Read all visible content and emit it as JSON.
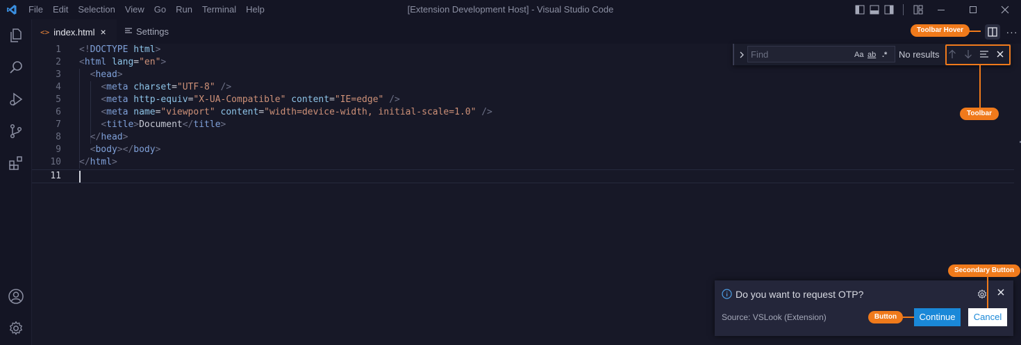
{
  "titlebar": {
    "menu": [
      "File",
      "Edit",
      "Selection",
      "View",
      "Go",
      "Run",
      "Terminal",
      "Help"
    ],
    "title": "[Extension Development Host] - Visual Studio Code"
  },
  "tabs": [
    {
      "label": "index.html",
      "icon": "html-file-icon",
      "close": "×",
      "active": true
    },
    {
      "label": "Settings",
      "icon": "settings-lines-icon",
      "active": false
    }
  ],
  "editor": {
    "line_numbers": [
      "1",
      "2",
      "3",
      "4",
      "5",
      "6",
      "7",
      "8",
      "9",
      "10",
      "11"
    ],
    "current_line": "11"
  },
  "find_widget": {
    "placeholder": "Find",
    "match_case": "Aa",
    "whole_word": "ab",
    "regex": ".*",
    "status": "No results"
  },
  "notification": {
    "message": "Do you want to request OTP?",
    "source": "Source: VSLook (Extension)",
    "primary_button": "Continue",
    "secondary_button": "Cancel"
  },
  "annotations": {
    "toolbar_hover": "Toolbar Hover",
    "toolbar": "Toolbar",
    "secondary_button": "Secondary Button",
    "button": "Button"
  },
  "colors": {
    "accent": "#f07a1b",
    "primary_button": "#1a88d8",
    "background": "#171827"
  }
}
